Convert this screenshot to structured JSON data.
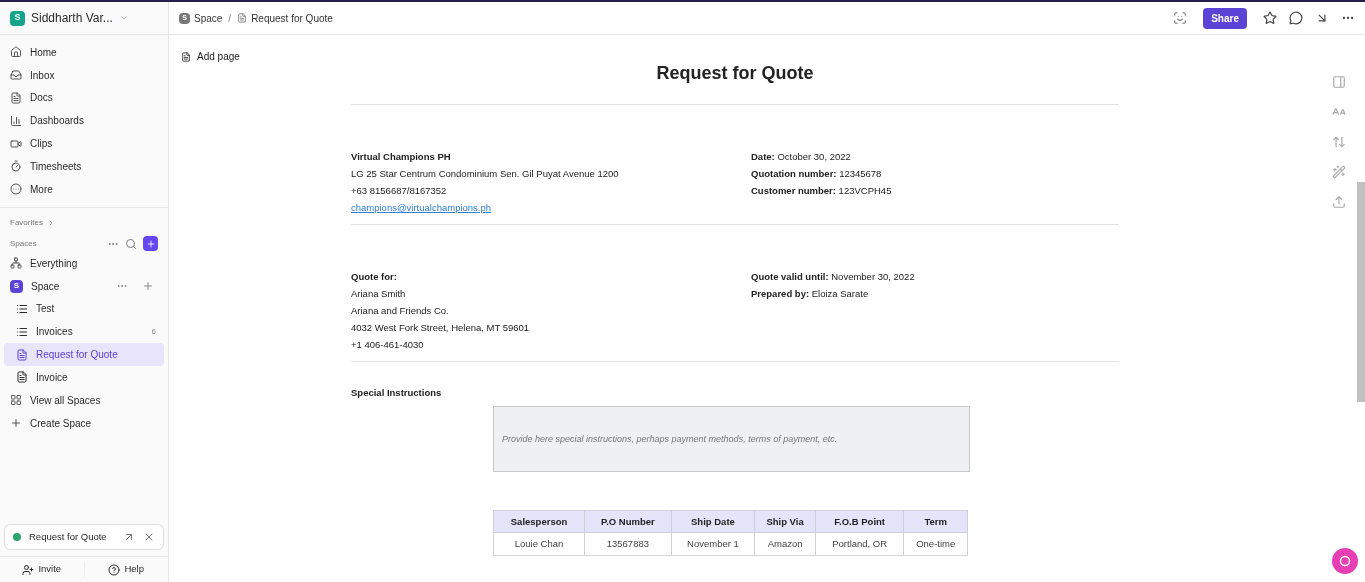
{
  "workspace": {
    "avatar": "S",
    "name": "Siddharth Var..."
  },
  "nav": [
    {
      "label": "Home"
    },
    {
      "label": "Inbox"
    },
    {
      "label": "Docs"
    },
    {
      "label": "Dashboards"
    },
    {
      "label": "Clips"
    },
    {
      "label": "Timesheets"
    },
    {
      "label": "More"
    }
  ],
  "favorites_label": "Favorites",
  "spaces_label": "Spaces",
  "everything_label": "Everything",
  "space": {
    "avatar": "S",
    "label": "Space",
    "children": [
      {
        "kind": "list",
        "label": "Test",
        "selected": false
      },
      {
        "kind": "list",
        "label": "Invoices",
        "count": "6",
        "selected": false
      },
      {
        "kind": "doc",
        "label": "Request for Quote",
        "selected": true
      },
      {
        "kind": "doc",
        "label": "Invoice",
        "selected": false
      }
    ]
  },
  "view_all_label": "View all Spaces",
  "create_label": "Create Space",
  "pinned_tab": {
    "label": "Request for Quote",
    "color": "#2ea56f"
  },
  "footer": [
    "Invite",
    "Help"
  ],
  "breadcrumb": {
    "space_avatar": "S",
    "space": "Space",
    "separator": "/",
    "page": "Request for Quote"
  },
  "share_label": "Share",
  "add_page": "Add page",
  "doc": {
    "title": "Request for Quote",
    "company": {
      "name": "Virtual Champions PH",
      "lines": [
        "LG 25 Star Centrum Condominium Sen. Gil Puyat Avenue 1200",
        "+63 8156687/8167352"
      ],
      "email": "champions@virtualchampions.ph"
    },
    "meta": [
      "**Date:** October 30, 2022",
      "**Quotation number:** 12345678",
      "**Customer number:** 123VCPH45"
    ],
    "quote_for": {
      "heading": "Quote for:",
      "lines": [
        "Ariana Smith",
        "Ariana and Friends Co.",
        "4032 West Fork Street, Helena, MT 59601",
        "+1 406-461-4030"
      ]
    },
    "validity": [
      "**Quote valid until:** November 30, 2022",
      "**Prepared by:** Eloiza Sarate"
    ],
    "special_heading": "Special Instructions",
    "special_placeholder": "Provide here special instructions, perhaps payment methods, terms of payment, etc.",
    "table": {
      "columns": [
        "Salesperson",
        "P.O Number",
        "Ship Date",
        "Ship Via",
        "F.O.B Point",
        "Term"
      ],
      "rows": [
        [
          "Louie Chan",
          "13567883",
          "November 1",
          "Amazon",
          "Portland, OR",
          "One-time"
        ]
      ]
    }
  }
}
